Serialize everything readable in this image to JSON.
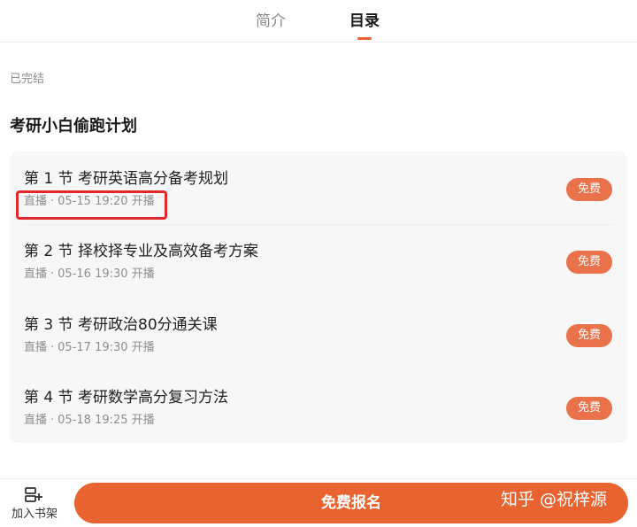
{
  "tabs": {
    "intro": "简介",
    "catalog": "目录"
  },
  "course": {
    "status": "已完结",
    "title": "考研小白偷跑计划"
  },
  "lessons": [
    {
      "number": "第 1 节",
      "title": "考研英语高分备考规划",
      "type": "直播",
      "sep": "·",
      "time": "05-15 19:20 开播",
      "badge": "免费"
    },
    {
      "number": "第 2 节",
      "title": "择校择专业及高效备考方案",
      "type": "直播",
      "sep": "·",
      "time": "05-16 19:30 开播",
      "badge": "免费"
    },
    {
      "number": "第 3 节",
      "title": "考研政治80分通关课",
      "type": "直播",
      "sep": "·",
      "time": "05-17 19:30 开播",
      "badge": "免费"
    },
    {
      "number": "第 4 节",
      "title": "考研数学高分复习方法",
      "type": "直播",
      "sep": "·",
      "time": "05-18 19:25 开播",
      "badge": "免费"
    }
  ],
  "bottom": {
    "shelf_label": "加入书架",
    "shelf_icon": "add-to-shelf-icon",
    "enroll_label": "免费报名"
  },
  "watermark": "知乎 @祝梓源",
  "colors": {
    "accent": "#e8632f",
    "badge": "#e9724a",
    "highlight": "#e02a2a"
  }
}
